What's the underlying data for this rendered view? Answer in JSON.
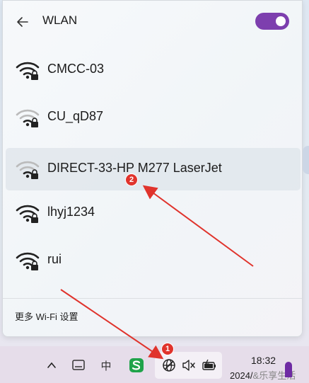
{
  "flyout": {
    "title": "WLAN",
    "wifi_enabled": true,
    "networks": [
      {
        "ssid": "CMCC-03",
        "secured": true,
        "signal": "full"
      },
      {
        "ssid": "CU_qD87",
        "secured": true,
        "signal": "partial"
      },
      {
        "ssid": "DIRECT-33-HP M277 LaserJet",
        "secured": true,
        "signal": "partial"
      },
      {
        "ssid": "lhyj1234",
        "secured": true,
        "signal": "full"
      },
      {
        "ssid": "rui",
        "secured": true,
        "signal": "full"
      }
    ],
    "more_settings_label": "更多 Wi-Fi 设置"
  },
  "taskbar": {
    "ime_label": "中",
    "clock_time": "18:32",
    "clock_date": "2024/",
    "watermark": "&乐享生活"
  },
  "annotations": {
    "badge1": "1",
    "badge2": "2"
  },
  "colors": {
    "accent": "#7d3fae",
    "annotation": "#e0332c"
  },
  "icons": [
    "back-arrow-icon",
    "wifi-locked-icon",
    "chevron-up-icon",
    "tablet-mode-icon",
    "ime-icon",
    "sogou-icon",
    "network-globe-icon",
    "speaker-muted-icon",
    "battery-icon"
  ]
}
